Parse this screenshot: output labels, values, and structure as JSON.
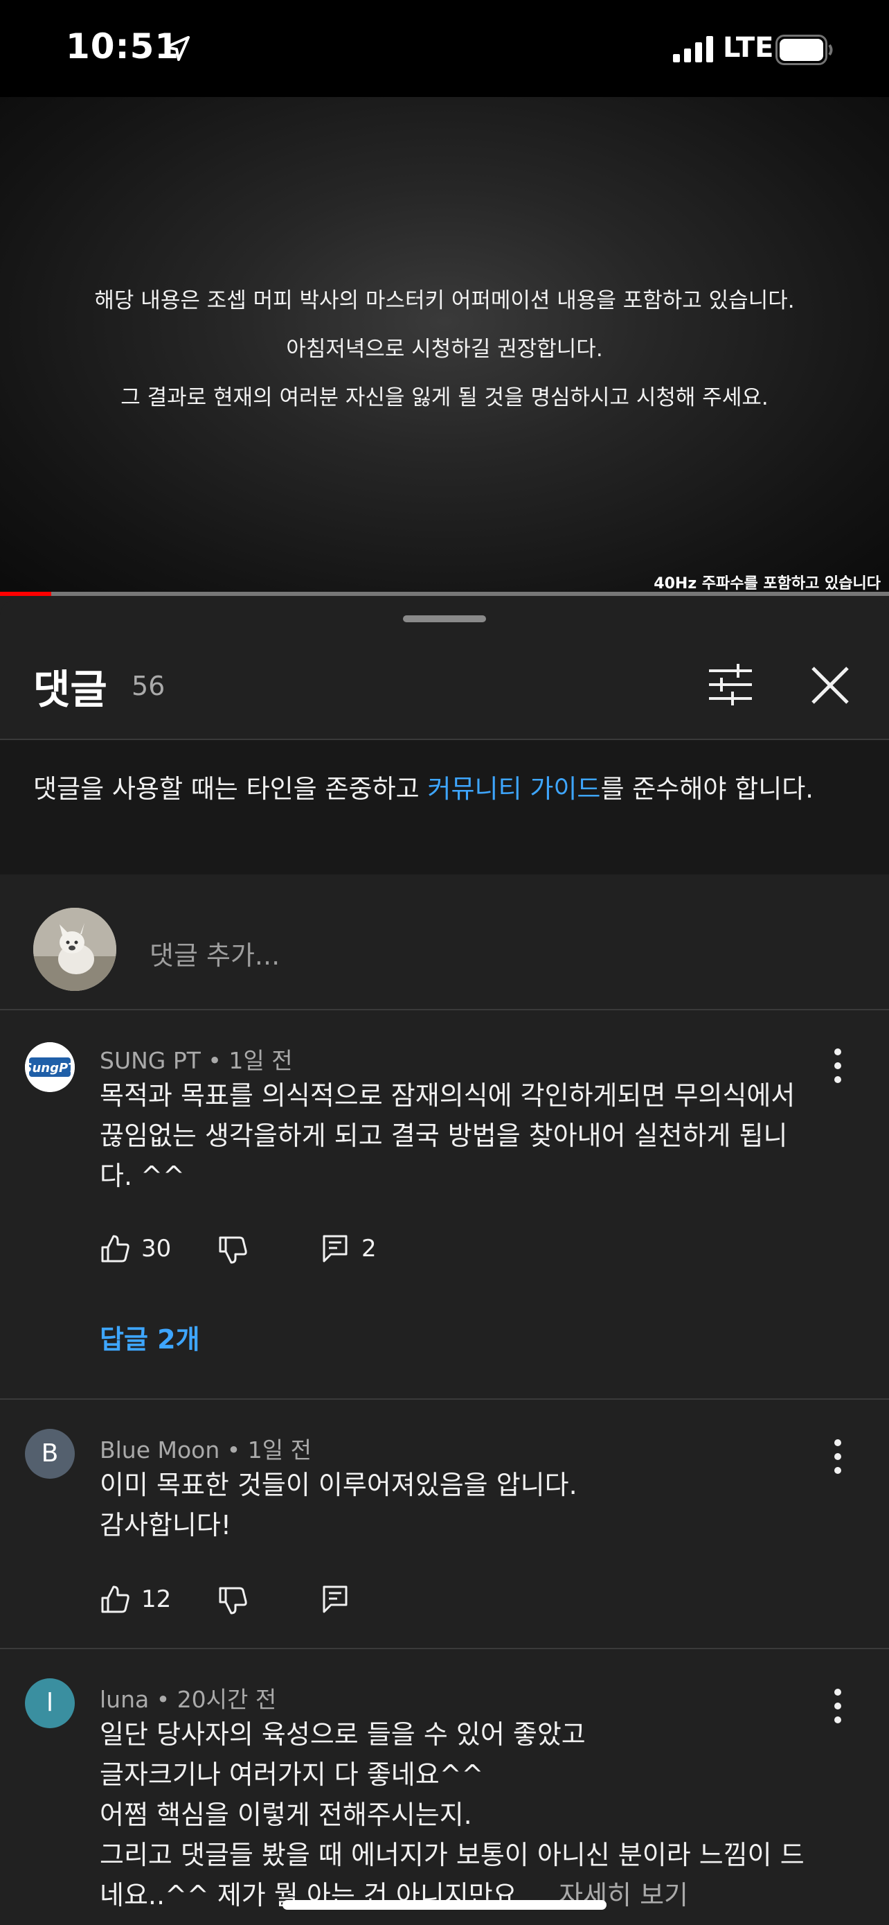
{
  "status_bar": {
    "time": "10:51",
    "network": "LTE"
  },
  "video": {
    "lines": [
      "해당 내용은 조셉 머피 박사의 마스터키 어퍼메이션 내용을 포함하고 있습니다.",
      "아침저녁으로 시청하길 권장합니다.",
      "그 결과로 현재의 여러분 자신을 잃게 될 것을 명심하시고 시청해 주세요."
    ],
    "caption": "40Hz 주파수를 포함하고 있습니다",
    "progress_fraction": 0.058
  },
  "comments_panel": {
    "title": "댓글",
    "count": "56",
    "notice_before": "댓글을 사용할 때는 타인을 존중하고 ",
    "notice_link": "커뮤니티 가이드",
    "notice_after": "를 준수해야 합니다.",
    "add_placeholder": "댓글 추가..."
  },
  "comments": [
    {
      "author": "SUNG PT",
      "time": "1일 전",
      "lines": [
        "목적과 목표를 의식적으로 잠재의식에 각인하게되면 무의식에서",
        "끊임없는 생각을하게 되고 결국 방법을 찾아내어 실천하게 됩니",
        "다. ^^"
      ],
      "likes": "30",
      "reply_count": "2",
      "replies_label": "답글 2개",
      "avatar_text": "SungPT",
      "avatar_color": "#ffffff"
    },
    {
      "author": "Blue Moon",
      "time": "1일 전",
      "lines": [
        "이미 목표한 것들이 이루어져있음을 압니다.",
        "감사합니다!"
      ],
      "likes": "12",
      "avatar_letter": "B",
      "avatar_color": "#54606e"
    },
    {
      "author": "luna",
      "time": "20시간 전",
      "lines": [
        "일단 당사자의 육성으로 들을 수 있어 좋았고",
        "글자크기나 여러가지 다 좋네요^^",
        "어쩜 핵심을 이렇게 전해주시는지.",
        "그리고 댓글들 봤을 때 에너지가 보통이 아니신 분이라 느낌이 드",
        "네요..^^ 제가 뭘 아는 건 아니지만요...."
      ],
      "read_more": "자세히 보기",
      "avatar_letter": "l",
      "avatar_color": "#3a8fa0"
    }
  ],
  "colors": {
    "link": "#3ea6ff",
    "progress": "#ff0000",
    "background": "#212121"
  }
}
